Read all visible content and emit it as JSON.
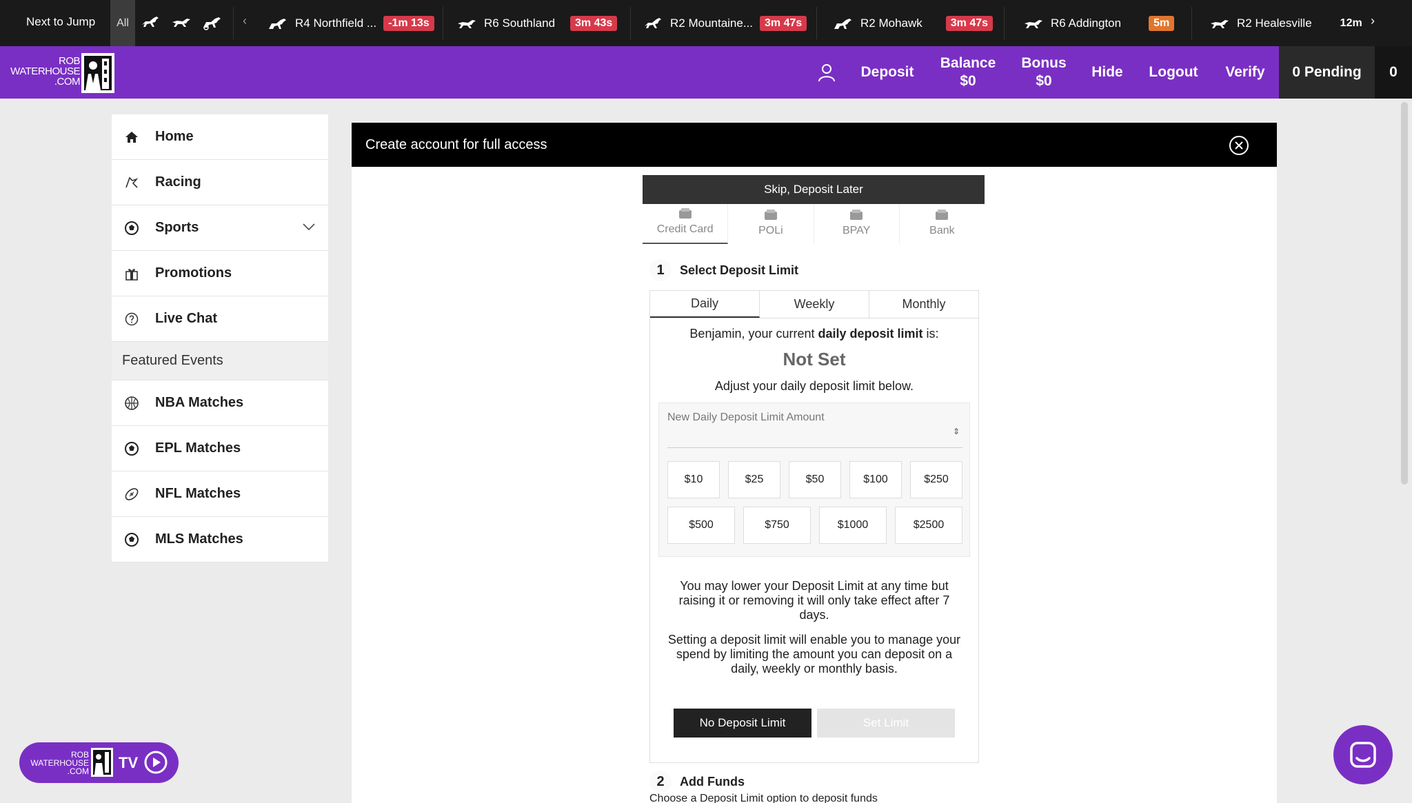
{
  "topbar": {
    "next_to_jump": "Next to Jump",
    "all": "All",
    "races": [
      {
        "venue": "R4  Northfield ...",
        "countdown": "-1m 13s",
        "color": "#d63a4a",
        "icon": "harness-icon"
      },
      {
        "venue": "R6  Southland",
        "countdown": "3m 43s",
        "color": "#d63a4a",
        "icon": "greyhound-icon"
      },
      {
        "venue": "R2  Mountaine...",
        "countdown": "3m 47s",
        "color": "#d63a4a",
        "icon": "horse-icon"
      },
      {
        "venue": "R2  Mohawk",
        "countdown": "3m 47s",
        "color": "#d63a4a",
        "icon": "harness-icon"
      },
      {
        "venue": "R6  Addington",
        "countdown": "5m",
        "color": "#e0762e",
        "icon": "greyhound-icon"
      },
      {
        "venue": "R2  Healesville",
        "countdown": "12m",
        "color": "",
        "icon": "greyhound-icon"
      }
    ]
  },
  "header": {
    "logo_line1": "ROB",
    "logo_line2": "WATERHOUSE",
    "logo_line3": ".COM",
    "deposit": "Deposit",
    "balance_label": "Balance",
    "balance_value": "$0",
    "bonus_label": "Bonus",
    "bonus_value": "$0",
    "hide": "Hide",
    "logout": "Logout",
    "verify": "Verify",
    "pending": "0 Pending",
    "count": "0"
  },
  "sidebar": {
    "items": [
      {
        "label": "Home",
        "icon": "home-icon"
      },
      {
        "label": "Racing",
        "icon": "racing-icon"
      },
      {
        "label": "Sports",
        "icon": "soccer-ball-icon"
      },
      {
        "label": "Promotions",
        "icon": "gift-icon"
      },
      {
        "label": "Live Chat",
        "icon": "help-icon"
      }
    ],
    "featured_title": "Featured Events",
    "featured": [
      {
        "label": "NBA Matches",
        "icon": "basketball-icon"
      },
      {
        "label": "EPL Matches",
        "icon": "soccer-ball-icon"
      },
      {
        "label": "NFL Matches",
        "icon": "football-icon"
      },
      {
        "label": "MLS Matches",
        "icon": "soccer-ball-icon"
      }
    ]
  },
  "main": {
    "banner": "Create account for full access",
    "skip": "Skip, Deposit Later",
    "payment_tabs": [
      "Credit Card",
      "POLi",
      "BPAY",
      "Bank"
    ],
    "step1_num": "1",
    "step1_title": "Select Deposit Limit",
    "limit_tabs": [
      "Daily",
      "Weekly",
      "Monthly"
    ],
    "current_prefix": "Benjamin, your current ",
    "current_bold": "daily deposit limit",
    "current_suffix": " is:",
    "not_set": "Not Set",
    "adjust": "Adjust your daily deposit limit below.",
    "input_label": "New Daily Deposit Limit Amount",
    "amounts_row1": [
      "$10",
      "$25",
      "$50",
      "$100",
      "$250"
    ],
    "amounts_row2": [
      "$500",
      "$750",
      "$1000",
      "$2500"
    ],
    "para1": "You may lower your Deposit Limit at any time but raising it or removing it will only take effect after 7 days.",
    "para2": "Setting a deposit limit will enable you to manage your spend by limiting the amount you can deposit on a daily, weekly or monthly basis.",
    "no_limit": "No Deposit Limit",
    "set_limit": "Set Limit",
    "step2_num": "2",
    "step2_title": "Add Funds",
    "choose": "Choose a Deposit Limit option to deposit funds"
  },
  "tv": {
    "logo_line1": "ROB",
    "logo_line2": "WATERHOUSE",
    "logo_line3": ".COM",
    "label": "TV"
  }
}
